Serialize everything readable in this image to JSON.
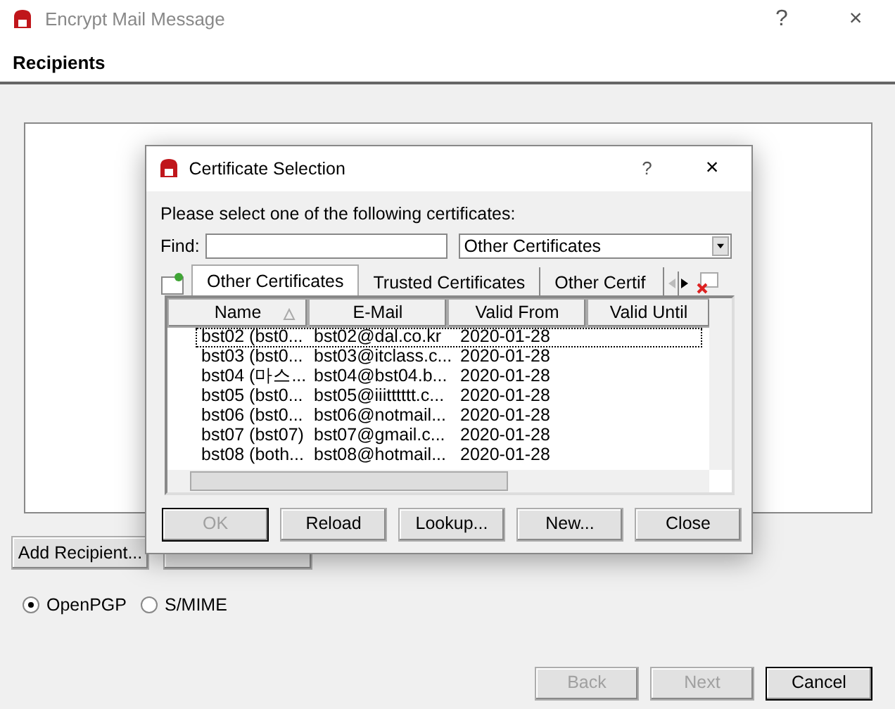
{
  "window": {
    "title": "Encrypt Mail Message",
    "help": "?",
    "close": "×"
  },
  "header": {
    "title": "Recipients"
  },
  "recipient_buttons": [
    {
      "kind": "labelled",
      "label": "Add Recipient..."
    },
    {
      "kind": "covered"
    }
  ],
  "protocols": [
    {
      "label": "OpenPGP",
      "selected": true
    },
    {
      "label": "S/MIME",
      "selected": false
    }
  ],
  "wizard_buttons": [
    {
      "label": "Back",
      "disabled": true
    },
    {
      "label": "Next",
      "disabled": true
    },
    {
      "label": "Cancel",
      "disabled": false
    }
  ],
  "dialog": {
    "title": "Certificate Selection",
    "help": "?",
    "close": "×",
    "prompt": "Please select one of the following certificates:",
    "find_label": "Find:",
    "filter": "Other Certificates",
    "tabs": [
      {
        "label": "Other Certificates",
        "selected": true
      },
      {
        "label": "Trusted Certificates",
        "selected": false
      },
      {
        "label": "Other Certif",
        "selected": false
      }
    ],
    "columns": [
      {
        "label": "Name",
        "sorted": true
      },
      {
        "label": "E-Mail",
        "sorted": false
      },
      {
        "label": "Valid From",
        "sorted": false
      },
      {
        "label": "Valid Until",
        "sorted": false
      }
    ],
    "rows": [
      {
        "name": "bst02 (bst0...",
        "email": "bst02@dal.co.kr",
        "valid_from": "2020-01-28",
        "selected": true
      },
      {
        "name": "bst03 (bst0...",
        "email": "bst03@itclass.c...",
        "valid_from": "2020-01-28",
        "selected": false
      },
      {
        "name": "bst04 (마스...",
        "email": "bst04@bst04.b...",
        "valid_from": "2020-01-28",
        "selected": false
      },
      {
        "name": "bst05 (bst0...",
        "email": "bst05@iiitttttt.c...",
        "valid_from": "2020-01-28",
        "selected": false
      },
      {
        "name": "bst06 (bst0...",
        "email": "bst06@notmail...",
        "valid_from": "2020-01-28",
        "selected": false
      },
      {
        "name": "bst07 (bst07)",
        "email": "bst07@gmail.c...",
        "valid_from": "2020-01-28",
        "selected": false
      },
      {
        "name": "bst08 (both...",
        "email": "bst08@hotmail...",
        "valid_from": "2020-01-28",
        "selected": false
      }
    ],
    "buttons": [
      {
        "label": "OK",
        "disabled": true
      },
      {
        "label": "Reload",
        "disabled": false
      },
      {
        "label": "Lookup...",
        "disabled": false
      },
      {
        "label": "New...",
        "disabled": false
      },
      {
        "label": "Close",
        "disabled": false
      }
    ]
  }
}
